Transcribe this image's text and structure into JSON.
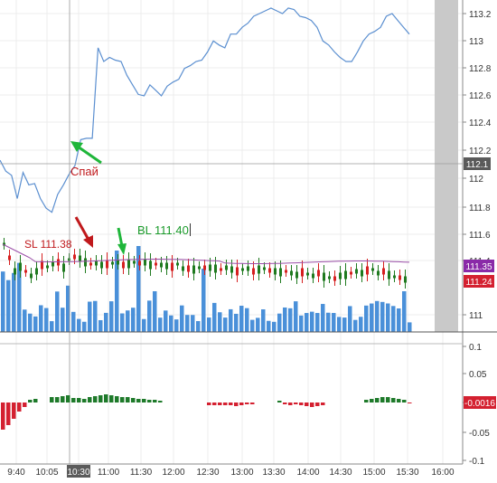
{
  "colors": {
    "price_line": "#5b8fd0",
    "candle_up": "#1f7a1f",
    "candle_down": "#d62020",
    "volume": "#4a90d9",
    "ma_line": "#9b4fa8",
    "osc_up": "#1e7a2a",
    "osc_down": "#d42030",
    "label_current": "#5a5a5a",
    "label_ma": "#8a2aa8",
    "label_close": "#d42030",
    "arrow_green": "#1fb63a",
    "arrow_red": "#c0191c",
    "shaded": "#c9c9c9",
    "crosshair": "#9a9a9a"
  },
  "annotations": {
    "spy": "Спай",
    "sl": "SL 111.38",
    "bl": "BL 111.40"
  },
  "price_axis": {
    "ticks": [
      "113.2",
      "113",
      "112.8",
      "112.6",
      "112.4",
      "112.2",
      "112",
      "111.8",
      "111.6",
      "111.4",
      "111"
    ],
    "current_label": "112.1",
    "ma_label": "111.35",
    "close_label": "111.24"
  },
  "osc_axis": {
    "ticks": [
      "0.1",
      "0.05",
      "0",
      "-0.05",
      "-0.1"
    ],
    "current_label": "-0.0016"
  },
  "time_axis": {
    "labels": [
      "9:40",
      "10:05",
      "10:30",
      "11:00",
      "11:30",
      "12:00",
      "12:30",
      "13:00",
      "13:30",
      "14:00",
      "14:30",
      "15:00",
      "15:30",
      "16:00"
    ],
    "highlighted": "10:30"
  },
  "chart_data": {
    "type": "line",
    "ylim": [
      111.85,
      113.3
    ],
    "crosshair_value": 112.1,
    "x": [
      "9:30",
      "9:35",
      "9:40",
      "9:45",
      "9:50",
      "9:55",
      "10:00",
      "10:05",
      "10:10",
      "10:15",
      "10:20",
      "10:25",
      "10:30",
      "10:35",
      "10:40",
      "10:45",
      "10:50",
      "10:55",
      "11:00",
      "11:05",
      "11:10",
      "11:15",
      "11:20",
      "11:25",
      "11:30",
      "11:35",
      "11:40",
      "11:45",
      "11:50",
      "11:55",
      "12:00",
      "12:05",
      "12:10",
      "12:15",
      "12:20",
      "12:25",
      "12:30",
      "12:35",
      "12:40",
      "12:45",
      "12:50",
      "12:55",
      "13:00",
      "13:05",
      "13:10",
      "13:15",
      "13:20",
      "13:25",
      "13:30",
      "13:35",
      "13:40",
      "13:45",
      "13:50",
      "13:55",
      "14:00",
      "14:05",
      "14:10",
      "14:15",
      "14:20",
      "14:25",
      "14:30",
      "14:35",
      "14:40",
      "14:45",
      "14:50",
      "14:55",
      "15:00",
      "15:05",
      "15:10",
      "15:15",
      "15:20",
      "15:25"
    ],
    "values": [
      112.13,
      112.05,
      112.02,
      111.85,
      112.04,
      111.95,
      111.96,
      111.85,
      111.78,
      111.75,
      111.88,
      111.95,
      112.03,
      112.09,
      112.28,
      112.29,
      112.29,
      112.95,
      112.85,
      112.88,
      112.86,
      112.85,
      112.75,
      112.68,
      112.61,
      112.6,
      112.68,
      112.64,
      112.6,
      112.67,
      112.7,
      112.72,
      112.8,
      112.82,
      112.85,
      112.86,
      112.92,
      113.0,
      112.97,
      112.95,
      113.05,
      113.05,
      113.1,
      113.13,
      113.18,
      113.2,
      113.22,
      113.24,
      113.22,
      113.2,
      113.24,
      113.23,
      113.18,
      113.17,
      113.15,
      113.1,
      113.0,
      112.97,
      112.92,
      112.88,
      112.85,
      112.85,
      112.92,
      113.0,
      113.05,
      113.07,
      113.1,
      113.18,
      113.2,
      113.15,
      113.1,
      113.05
    ]
  }
}
